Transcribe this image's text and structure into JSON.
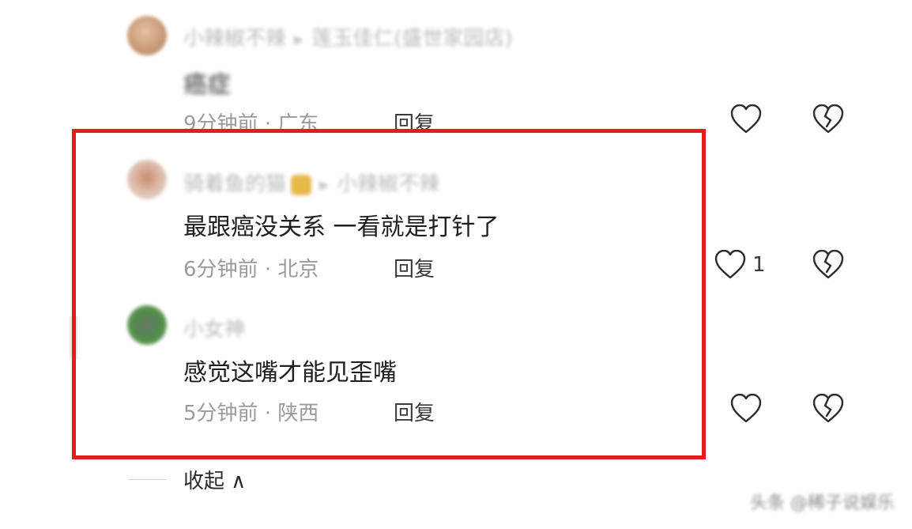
{
  "comments": [
    {
      "username": "小辣椒不辣",
      "reply_to": "莲玉佳仁(盛世家园店)",
      "text": "癌症",
      "time": "9分钟前",
      "location": "广东",
      "reply_label": "回复",
      "like_count": ""
    },
    {
      "username": "骑着鱼的猫",
      "reply_to": "小辣椒不辣",
      "text": "最跟癌没关系 一看就是打针了",
      "time": "6分钟前",
      "location": "北京",
      "reply_label": "回复",
      "like_count": "1"
    },
    {
      "username": "小女神",
      "reply_to": "",
      "text": "感觉这嘴才能见歪嘴",
      "time": "5分钟前",
      "location": "陕西",
      "reply_label": "回复",
      "like_count": ""
    }
  ],
  "separator": "·",
  "collapse_label": "收起 ∧",
  "watermark": "头条 @稀子说娱乐",
  "colors": {
    "highlight_border": "#e41c1c",
    "meta_text": "#9a9a9a",
    "body_text": "#1e1e1e"
  },
  "icons": {
    "like": "heart-outline-icon",
    "dislike": "broken-heart-icon",
    "reply_arrow": "triangle-right-icon"
  }
}
